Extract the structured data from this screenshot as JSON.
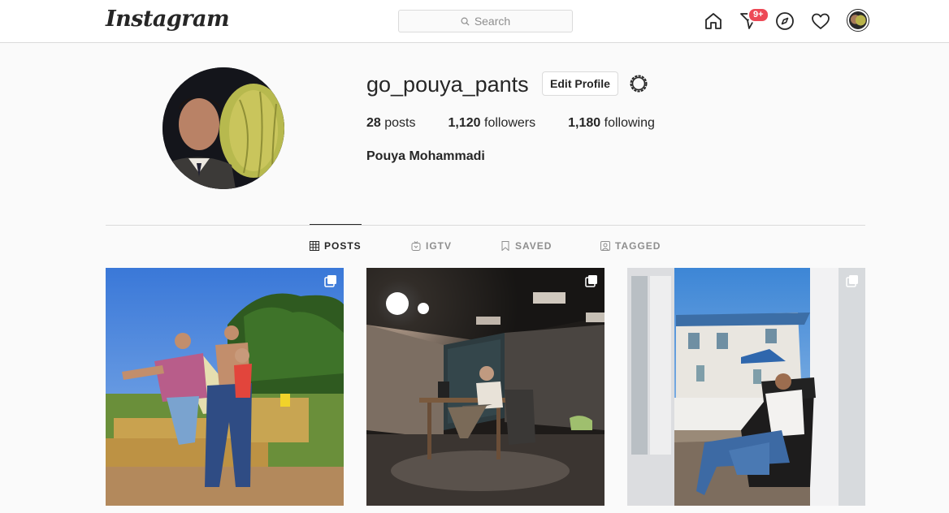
{
  "header": {
    "logo": "Instagram",
    "search_placeholder": "Search",
    "notification_badge": "9+"
  },
  "profile": {
    "username": "go_pouya_pants",
    "edit_label": "Edit Profile",
    "posts_count": "28",
    "posts_label": "posts",
    "followers_count": "1,120",
    "followers_label": "followers",
    "following_count": "1,180",
    "following_label": "following",
    "full_name": "Pouya Mohammadi"
  },
  "tabs": [
    {
      "label": "POSTS",
      "icon": "grid-icon",
      "active": true
    },
    {
      "label": "IGTV",
      "icon": "igtv-icon",
      "active": false
    },
    {
      "label": "SAVED",
      "icon": "bookmark-icon",
      "active": false
    },
    {
      "label": "TAGGED",
      "icon": "tag-icon",
      "active": false
    }
  ],
  "posts": [
    {
      "scene": "outdoor-hay-bales",
      "multiple": true
    },
    {
      "scene": "dark-stage-desk",
      "multiple": true
    },
    {
      "scene": "porch-rocking-chair",
      "multiple": true
    }
  ],
  "colors": {
    "accent": "#0095f6",
    "badge": "#ed4956",
    "border": "#dbdbdb",
    "text": "#262626",
    "muted": "#8e8e8e"
  }
}
